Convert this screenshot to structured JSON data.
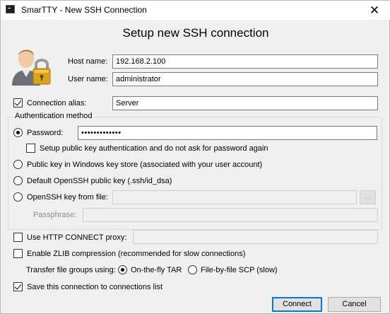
{
  "window": {
    "title": "SmarTTY - New SSH Connection",
    "close_glyph": "✕"
  },
  "heading": "Setup new SSH connection",
  "icons": {
    "app": "terminal-icon",
    "user_lock": "user-lock-icon",
    "close": "close-icon"
  },
  "host": {
    "label": "Host name:",
    "value": "192.168.2.100"
  },
  "user": {
    "label": "User name:",
    "value": "administrator"
  },
  "alias": {
    "label": "Connection alias:",
    "checked": true,
    "value": "Server"
  },
  "auth": {
    "group_title": "Authentication method",
    "password": {
      "label": "Password:",
      "selected": true,
      "value": "•••••••••••••"
    },
    "setup_pubkey": {
      "label": "Setup public key authentication and do not ask for password again",
      "checked": false
    },
    "windows_store": {
      "label": "Public key in Windows key store (associated with your user account)",
      "selected": false
    },
    "default_openssh": {
      "label": "Default OpenSSH public key (.ssh/id_dsa)",
      "selected": false
    },
    "openssh_file": {
      "label": "OpenSSH key from file:",
      "selected": false,
      "value": "",
      "browse_label": "..."
    },
    "passphrase": {
      "label": "Passphrase:",
      "value": ""
    }
  },
  "http_proxy": {
    "label": "Use HTTP CONNECT proxy:",
    "checked": false,
    "value": ""
  },
  "zlib": {
    "label": "Enable ZLIB compression (recommended for slow connections)",
    "checked": false
  },
  "transfer": {
    "label": "Transfer file groups using:",
    "options": [
      {
        "label": "On-the-fly TAR",
        "selected": true
      },
      {
        "label": "File-by-file SCP (slow)",
        "selected": false
      }
    ]
  },
  "save": {
    "label": "Save this connection to connections list",
    "checked": true
  },
  "buttons": {
    "connect": "Connect",
    "cancel": "Cancel"
  }
}
